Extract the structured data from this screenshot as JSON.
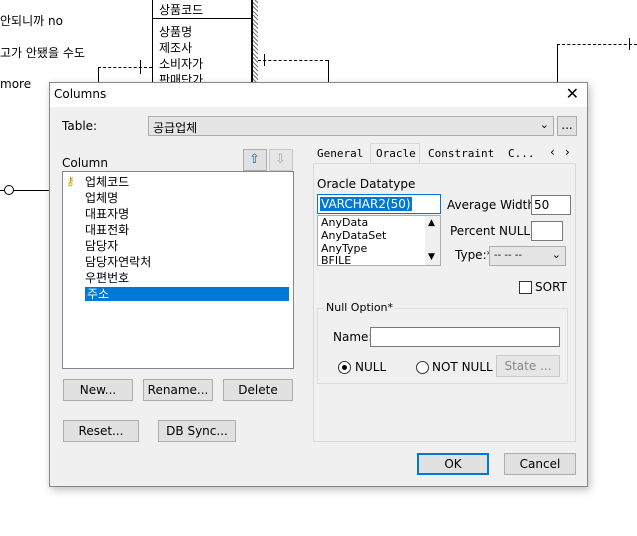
{
  "background": {
    "lines": [
      "안되니까 no",
      "고가 안됐을 수도",
      "more"
    ],
    "entity_rows": [
      "상품코드",
      "상품명",
      "제조사",
      "소비자가",
      "판매단가"
    ]
  },
  "dialog": {
    "title": "Columns",
    "close_glyph": "✕",
    "table_label": "Table:",
    "table_value": "공급업체",
    "table_more": "...",
    "column_label": "Column",
    "columns": [
      "업체코드",
      "업체명",
      "대표자명",
      "대표전화",
      "담당자",
      "담당자연락처",
      "우편번호",
      "주소"
    ],
    "selected_column": "주소",
    "buttons": {
      "new": "New...",
      "rename": "Rename...",
      "delete": "Delete",
      "reset": "Reset...",
      "db_sync": "DB Sync...",
      "ok": "OK",
      "cancel": "Cancel"
    },
    "tabs": [
      "General",
      "Oracle",
      "Constraint",
      "C..."
    ],
    "active_tab": "Oracle",
    "oracle": {
      "datatype_label": "Oracle Datatype",
      "datatype_value": "VARCHAR2(50)",
      "datatype_options": [
        "AnyData",
        "AnyDataSet",
        "AnyType",
        "BFILE"
      ],
      "avg_width_label": "Average Width:",
      "avg_width_value": "50",
      "percent_null_label": "Percent NULL:*",
      "percent_null_value": "",
      "type_label": "Type:*",
      "type_value": "-- -- --",
      "sort_label": "SORT",
      "null_option_title": "Null Option*",
      "name_label": "Name:",
      "name_value": "",
      "null_label": "NULL",
      "not_null_label": "NOT NULL",
      "state_label": "State ...",
      "null_selected": "NULL"
    }
  }
}
